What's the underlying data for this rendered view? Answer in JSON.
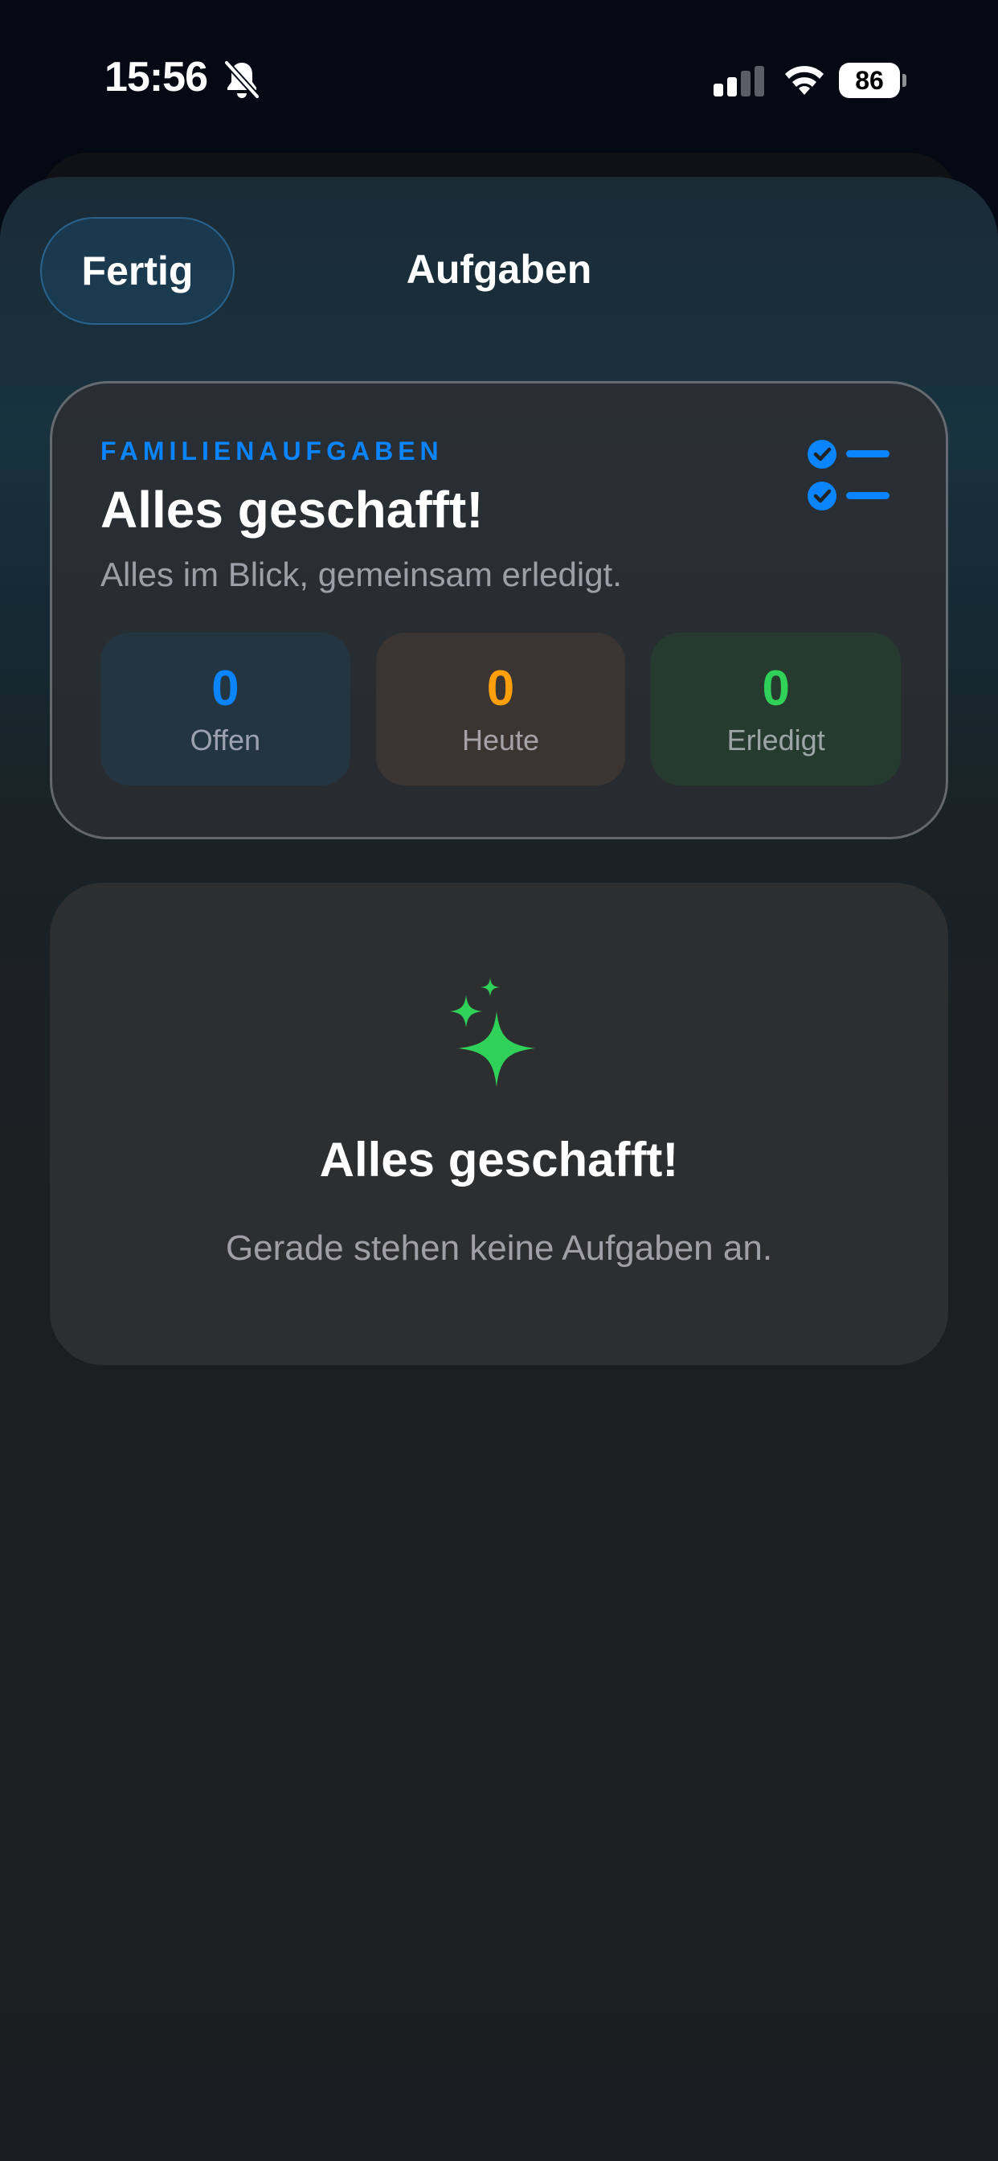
{
  "status_bar": {
    "time": "15:56",
    "battery": "86"
  },
  "nav": {
    "done_label": "Fertig",
    "title": "Aufgaben"
  },
  "summary": {
    "eyebrow": "FAMILIENAUFGABEN",
    "title": "Alles geschafft!",
    "subtitle": "Alles im Blick, gemeinsam erledigt.",
    "stats": [
      {
        "value": "0",
        "label": "Offen",
        "color": "#0a84ff"
      },
      {
        "value": "0",
        "label": "Heute",
        "color": "#ff9f0a"
      },
      {
        "value": "0",
        "label": "Erledigt",
        "color": "#30d158"
      }
    ]
  },
  "empty_state": {
    "title": "Alles geschafft!",
    "subtitle": "Gerade stehen keine Aufgaben an.",
    "icon": "sparkles-icon",
    "icon_color": "#30d158"
  },
  "colors": {
    "accent": "#0a84ff",
    "background": "#040914"
  }
}
